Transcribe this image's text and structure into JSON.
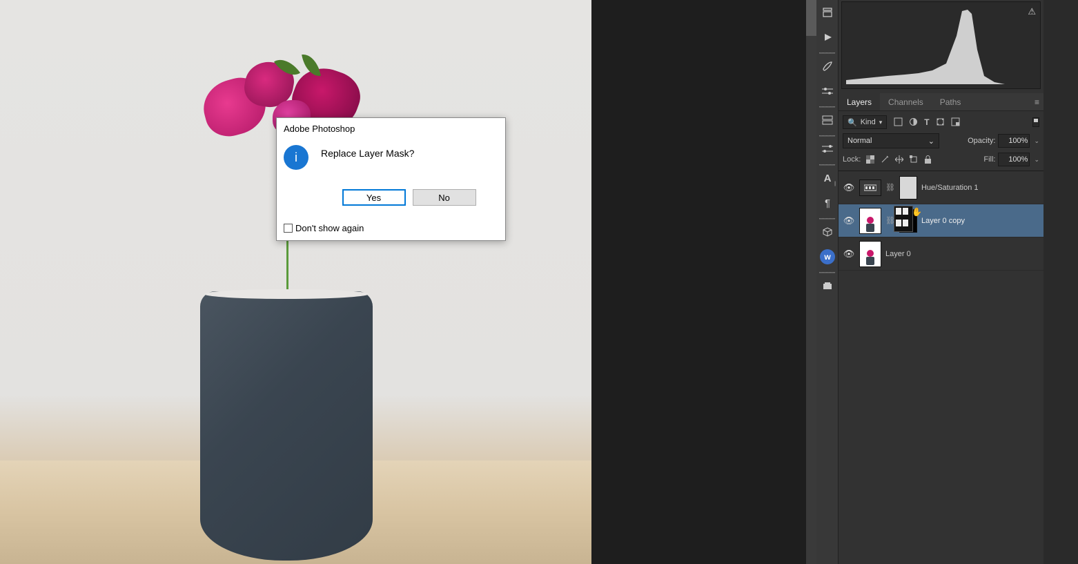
{
  "dialog": {
    "title": "Adobe Photoshop",
    "message": "Replace Layer Mask?",
    "yes_label": "Yes",
    "no_label": "No",
    "dont_show_label": "Don't show again"
  },
  "panel_tabs": {
    "layers": "Layers",
    "channels": "Channels",
    "paths": "Paths"
  },
  "layer_panel": {
    "kind_label": "Kind",
    "blend_mode": "Normal",
    "opacity_label": "Opacity:",
    "opacity_value": "100%",
    "lock_label": "Lock:",
    "fill_label": "Fill:",
    "fill_value": "100%"
  },
  "layers": {
    "0": {
      "name": "Hue/Saturation 1"
    },
    "1": {
      "name": "Layer 0 copy"
    },
    "2": {
      "name": "Layer 0"
    }
  },
  "icons": {
    "search": "🔍",
    "info": "i",
    "warning": "⚠"
  }
}
